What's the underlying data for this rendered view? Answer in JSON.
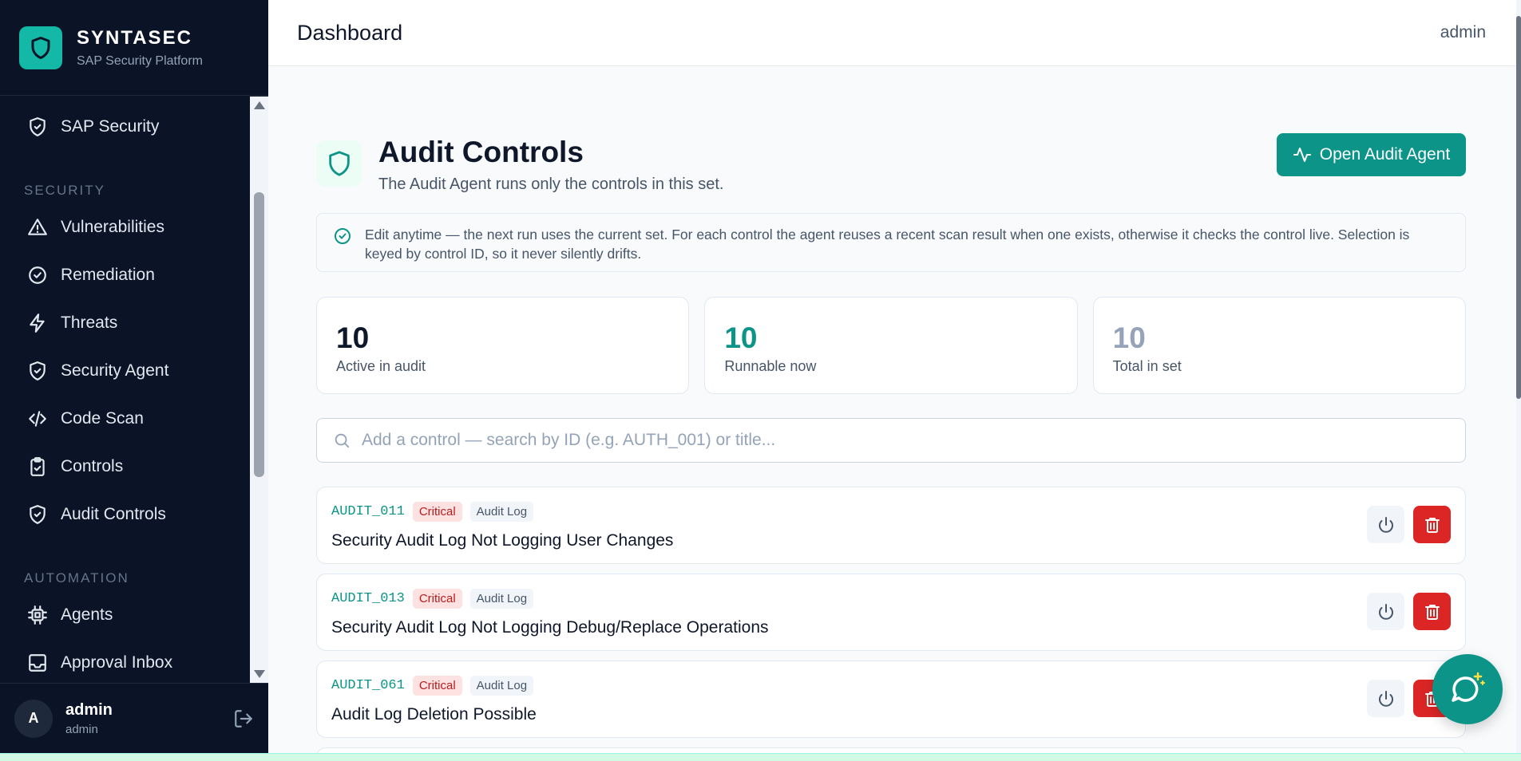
{
  "brand": {
    "name": "SYNTASEC",
    "subtitle": "SAP Security Platform"
  },
  "sidebar": {
    "items_top": [
      {
        "label": "SAP Security",
        "icon": "shield-check-icon"
      }
    ],
    "section_security": "SECURITY",
    "security_items": [
      {
        "label": "Vulnerabilities",
        "icon": "warning-triangle-icon"
      },
      {
        "label": "Remediation",
        "icon": "check-circle-icon"
      },
      {
        "label": "Threats",
        "icon": "lightning-icon"
      },
      {
        "label": "Security Agent",
        "icon": "shield-check-icon"
      },
      {
        "label": "Code Scan",
        "icon": "code-icon"
      },
      {
        "label": "Controls",
        "icon": "clipboard-check-icon"
      },
      {
        "label": "Audit Controls",
        "icon": "shield-check-icon"
      }
    ],
    "section_automation": "AUTOMATION",
    "automation_items": [
      {
        "label": "Agents",
        "icon": "cpu-icon"
      },
      {
        "label": "Approval Inbox",
        "icon": "inbox-icon"
      }
    ],
    "user": {
      "avatar": "A",
      "name": "admin",
      "role": "admin"
    }
  },
  "header": {
    "title": "Dashboard",
    "user": "admin"
  },
  "page": {
    "title": "Audit Controls",
    "subtitle": "The Audit Agent runs only the controls in this set.",
    "agent_button": "Open Audit Agent",
    "notice": "Edit anytime — the next run uses the current set. For each control the agent reuses a recent scan result when one exists, otherwise it checks the control live. Selection is keyed by control ID, so it never silently drifts.",
    "stats": [
      {
        "value": "10",
        "label": "Active in audit",
        "color": "#0f172a"
      },
      {
        "value": "10",
        "label": "Runnable now",
        "color": "#0d9488"
      },
      {
        "value": "10",
        "label": "Total in set",
        "color": "#94a3b8"
      }
    ],
    "search_placeholder": "Add a control — search by ID (e.g. AUTH_001) or title...",
    "controls": [
      {
        "id": "AUDIT_011",
        "severity": "Critical",
        "category": "Audit Log",
        "title": "Security Audit Log Not Logging User Changes"
      },
      {
        "id": "AUDIT_013",
        "severity": "Critical",
        "category": "Audit Log",
        "title": "Security Audit Log Not Logging Debug/Replace Operations"
      },
      {
        "id": "AUDIT_061",
        "severity": "Critical",
        "category": "Audit Log",
        "title": "Audit Log Deletion Possible"
      }
    ]
  },
  "colors": {
    "accent": "#0d9488",
    "sidebar_bg": "#0b1327",
    "danger": "#dc2626"
  }
}
